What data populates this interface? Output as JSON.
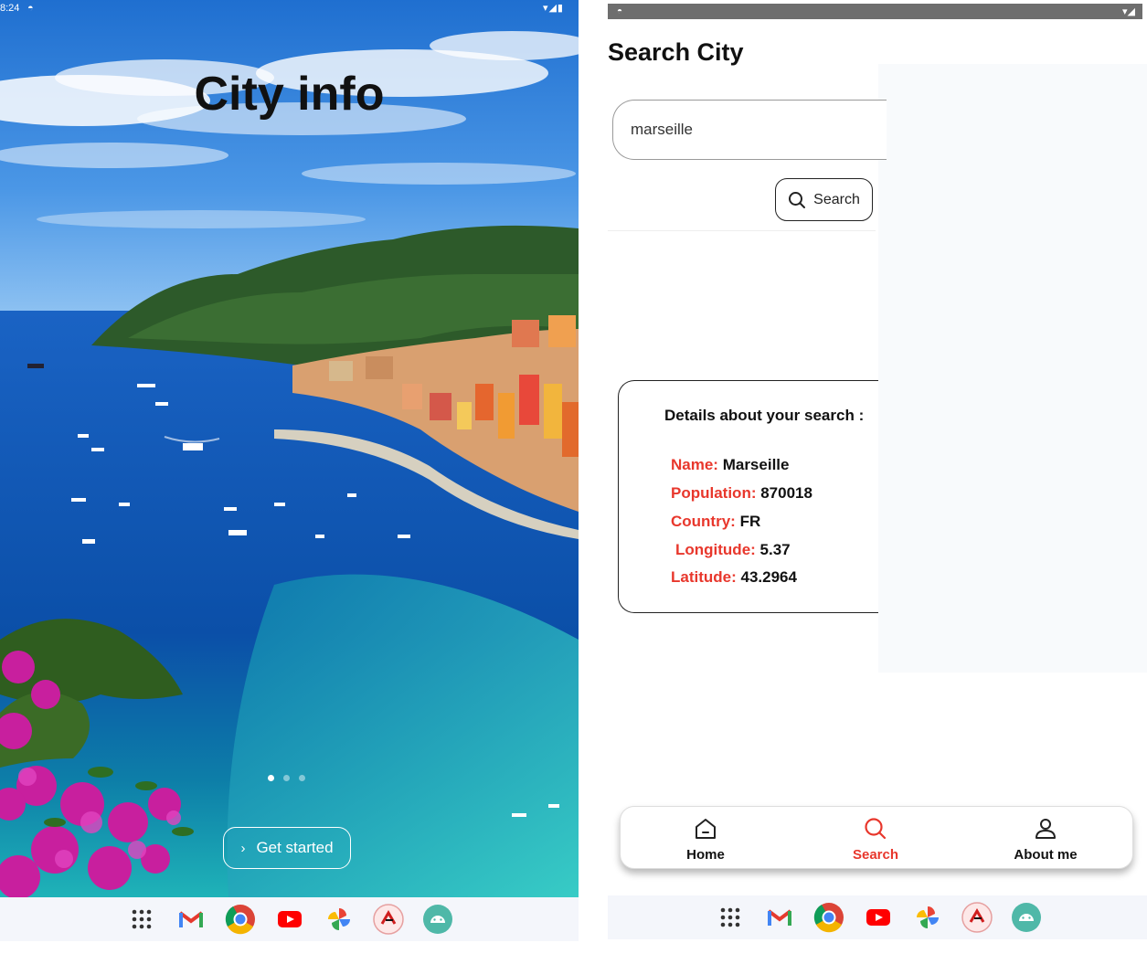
{
  "left_screen": {
    "status": {
      "time": "8:24"
    },
    "title": "City info",
    "pager": {
      "count": 3,
      "active_index": 0
    },
    "get_started_label": "Get started",
    "dock_icons": [
      "apps-grid-icon",
      "gmail-icon",
      "chrome-icon",
      "youtube-icon",
      "photos-icon",
      "app-red-icon",
      "android-app-icon"
    ]
  },
  "right_screen": {
    "page_title": "Search City",
    "search": {
      "value": "marseille",
      "placeholder": "",
      "button_label": "Search"
    },
    "details": {
      "heading": "Details about your search :",
      "name_label": "Name:",
      "name_value": "Marseille",
      "population_label": "Population:",
      "population_value": "870018",
      "country_label": "Country:",
      "country_value": "FR",
      "longitude_label": "Longitude:",
      "longitude_value": "5.37",
      "latitude_label": "Latitude:",
      "latitude_value": "43.2964"
    },
    "nav": {
      "home": "Home",
      "search": "Search",
      "about": "About me",
      "active": "search"
    },
    "dock_icons": [
      "apps-grid-icon",
      "gmail-icon",
      "chrome-icon",
      "youtube-icon",
      "photos-icon",
      "app-red-icon",
      "android-app-icon"
    ]
  },
  "colors": {
    "accent": "#e8372c",
    "text": "#111111",
    "sky": "#2f7fd6",
    "sea": "#0a5cb0",
    "dock_bg": "#f4f6fb"
  }
}
